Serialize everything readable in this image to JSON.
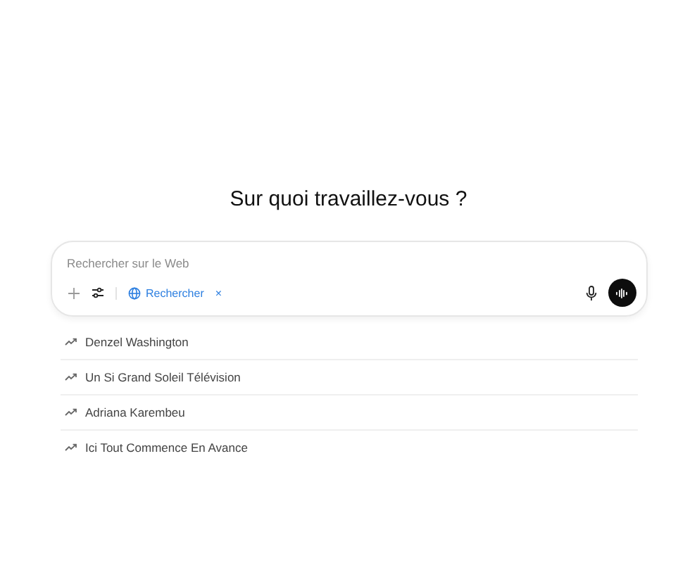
{
  "heading": "Sur quoi travaillez-vous ?",
  "composer": {
    "placeholder": "Rechercher sur le Web",
    "tool_chip": {
      "label": "Rechercher",
      "remove": "×"
    }
  },
  "suggestions": [
    {
      "label": "Denzel Washington"
    },
    {
      "label": "Un Si Grand Soleil Télévision"
    },
    {
      "label": "Adriana Karembeu"
    },
    {
      "label": "Ici Tout Commence En Avance"
    }
  ]
}
